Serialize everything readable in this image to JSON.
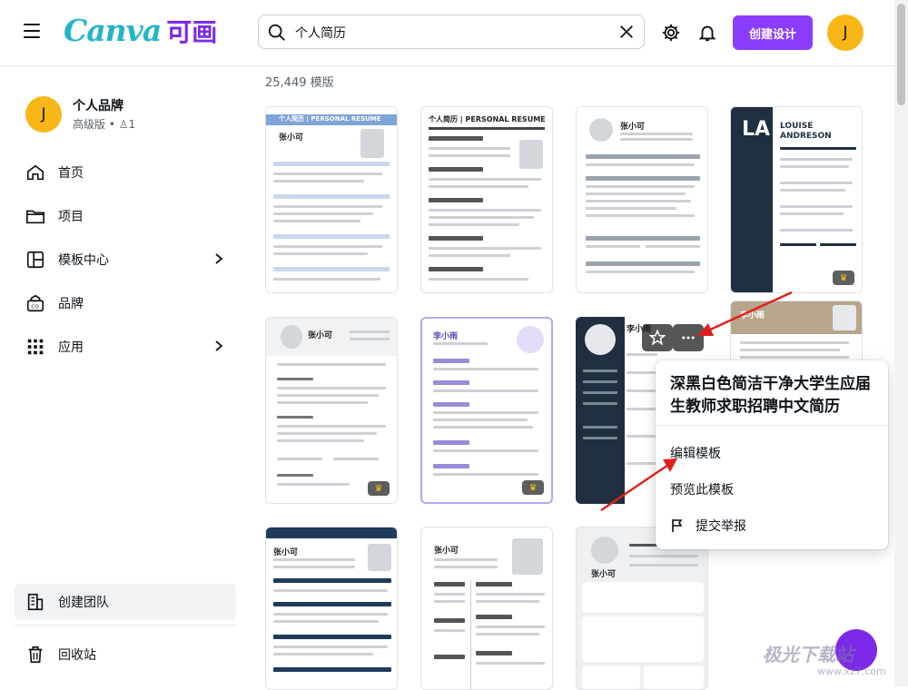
{
  "header": {
    "logo_text": "Canva",
    "logo_cn": "可画",
    "search_value": "个人简历",
    "create_button": "创建设计",
    "avatar_initial": "J"
  },
  "sidebar": {
    "brand_initial": "J",
    "brand_name": "个人品牌",
    "brand_sub": "高级版 • ♙1",
    "items": [
      {
        "label": "首页"
      },
      {
        "label": "项目"
      },
      {
        "label": "模板中心"
      },
      {
        "label": "品牌"
      },
      {
        "label": "应用"
      }
    ],
    "team_label": "创建团队",
    "trash_label": "回收站"
  },
  "main": {
    "count_label": "25,449 模版",
    "cards": [
      {
        "name": "个人简历 | PERSONAL RESUME",
        "person": "张小可"
      },
      {
        "name": "个人简历 | PERSONAL RESUME",
        "person": ""
      },
      {
        "name": "",
        "person": "张小可"
      },
      {
        "name": "LOUISE ANDRESON",
        "person": "LA"
      },
      {
        "name": "",
        "person": "张小可"
      },
      {
        "name": "",
        "person": "李小雨"
      },
      {
        "name": "",
        "person": "李小雨"
      },
      {
        "name": "",
        "person": "李小雨"
      },
      {
        "name": "",
        "person": "张小可"
      },
      {
        "name": "",
        "person": "张小可"
      },
      {
        "name": "",
        "person": "张小可"
      }
    ]
  },
  "popup": {
    "title": "深黑白色简洁干净大学生应届生教师求职招聘中文简历",
    "edit": "编辑模板",
    "preview": "预览此模板",
    "report": "提交举报"
  },
  "watermark": {
    "text": "极光下载站",
    "sub": "www.xz7.com"
  },
  "colors": {
    "accent": "#8b3dff",
    "avatar": "#f8b716",
    "arrow": "#e02020"
  }
}
